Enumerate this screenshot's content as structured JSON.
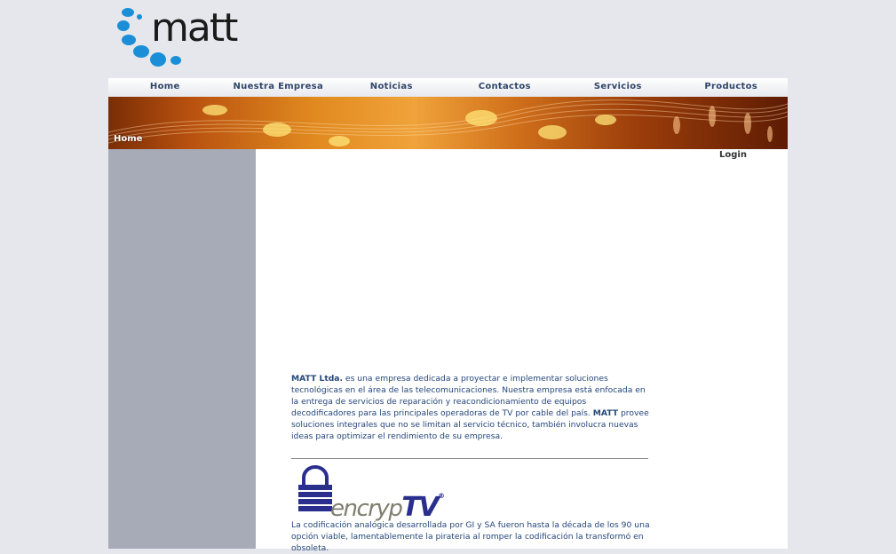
{
  "logo": {
    "text": "matt"
  },
  "nav": {
    "items": [
      "Home",
      "Nuestra Empresa",
      "Noticias",
      "Contactos",
      "Servicios",
      "Productos"
    ]
  },
  "banner": {
    "label": "Home"
  },
  "content": {
    "login": "Login",
    "intro": {
      "company": "MATT Ltda.",
      "text1": " es una empresa dedicada a proyectar e implementar soluciones tecnológicas en el área de las telecomunicaciones. Nuestra empresa está enfocada en la entrega de servicios de reparación y reacondicionamiento de equipos decodificadores para las principales operadoras de TV por cable del país. ",
      "company2": "MATT",
      "text2": " provee soluciones integrales que no se limitan al servicio técnico, también involucra nuevas ideas para optimizar el rendimiento de su empresa."
    },
    "product_logo": {
      "prefix": "encryp",
      "suffix": "TV",
      "mark": "®"
    },
    "product_desc": "La codificación analógica desarrollada por GI y SA fueron hasta la década de los 90 una opción viable, lamentablemente la pirateria al romper la codificación la transformó en obsoleta."
  },
  "colors": {
    "page_bg": "#e5e7ec",
    "nav_text": "#2f4568",
    "sidebar": "#a6abb7",
    "body_text": "#24467a",
    "logo_blue": "#1a8fd8"
  }
}
